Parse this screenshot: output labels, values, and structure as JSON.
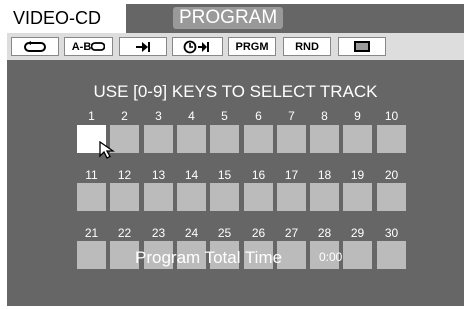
{
  "header": {
    "mode_tab": "VIDEO-CD",
    "screen_title": "PROGRAM"
  },
  "toolbar": {
    "repeat_icon": "repeat-icon",
    "ab_repeat_label": "A-B",
    "intro_icon": "intro-scan-icon",
    "time_search_icon": "time-search-icon",
    "program_label": "PRGM",
    "random_label": "RND",
    "display_icon": "screen-icon"
  },
  "instruction": "USE [0-9] KEYS TO SELECT TRACK",
  "tracks": {
    "selected": 1,
    "rows": [
      [
        "1",
        "2",
        "3",
        "4",
        "5",
        "6",
        "7",
        "8",
        "9",
        "10"
      ],
      [
        "11",
        "12",
        "13",
        "14",
        "15",
        "16",
        "17",
        "18",
        "19",
        "20"
      ],
      [
        "21",
        "22",
        "23",
        "24",
        "25",
        "26",
        "27",
        "28",
        "29",
        "30"
      ]
    ]
  },
  "total": {
    "label": "Program Total Time",
    "value": "0:00"
  },
  "colors": {
    "background": "#666666",
    "cell": "#bbbbbb",
    "selected_cell": "#ffffff",
    "toolbar": "#dddddd"
  }
}
